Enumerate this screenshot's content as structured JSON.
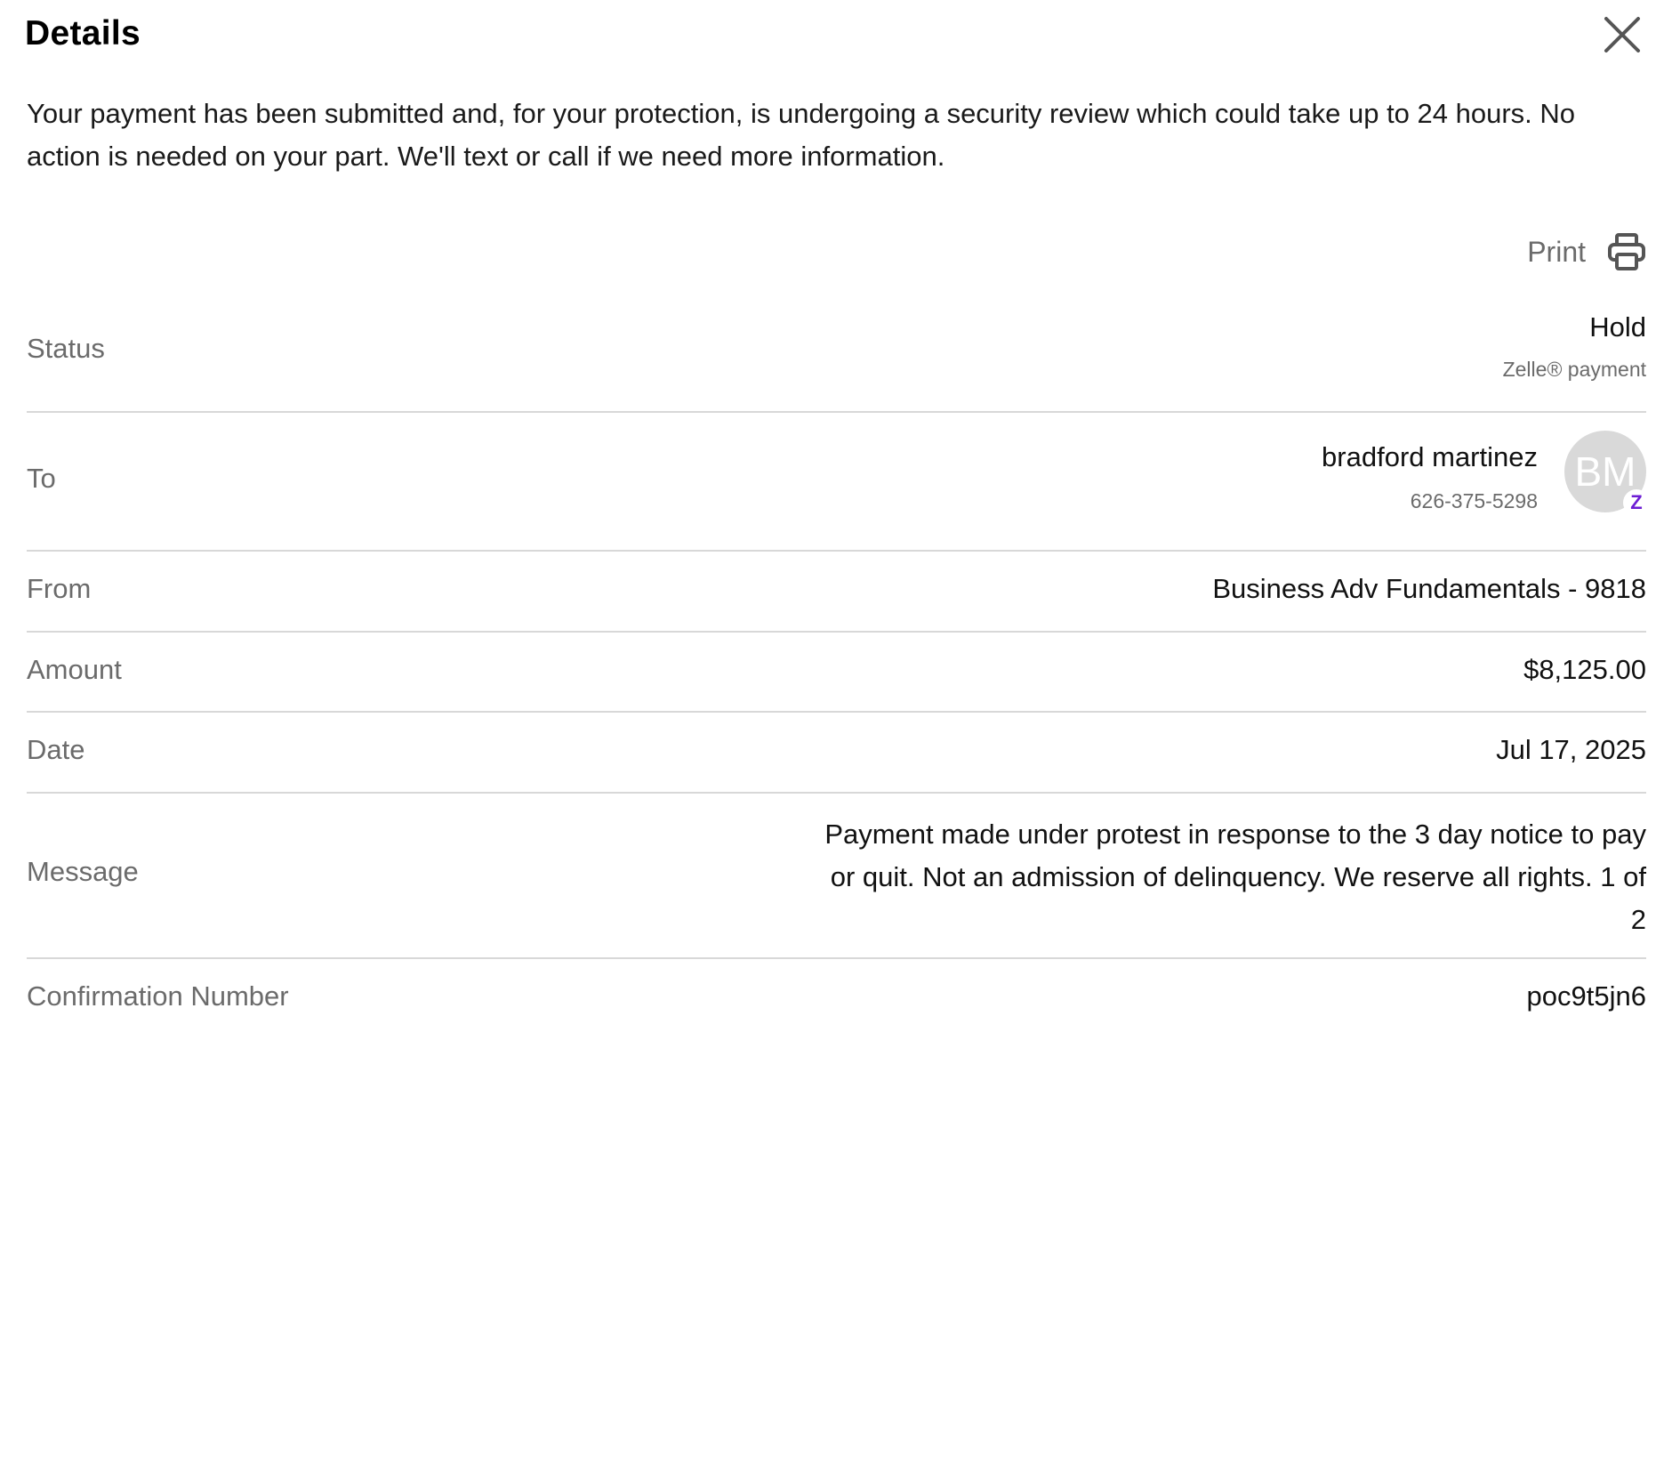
{
  "header": {
    "title": "Details"
  },
  "intro_text": "Your payment has been submitted and, for your protection, is undergoing a security review which could take up to 24 hours. No action is needed on your part. We'll text or call if we need more information.",
  "print": {
    "label": "Print",
    "icon": "printer-icon"
  },
  "details": {
    "status": {
      "label": "Status",
      "value": "Hold",
      "sub": "Zelle® payment"
    },
    "to": {
      "label": "To",
      "name": "bradford martinez",
      "phone": "626-375-5298",
      "avatar_initials": "BM",
      "badge_glyph": "Z",
      "badge_color": "#6d1ed4"
    },
    "from": {
      "label": "From",
      "value": "Business Adv Fundamentals - 9818"
    },
    "amount": {
      "label": "Amount",
      "value": "$8,125.00"
    },
    "date": {
      "label": "Date",
      "value": "Jul 17, 2025"
    },
    "message": {
      "label": "Message",
      "line1": "Payment made under protest in response to the 3 day notice to pay",
      "line2": "or quit. Not an admission of delinquency. We reserve all rights. 1 of",
      "line3": "2"
    },
    "confirmation": {
      "label": "Confirmation Number",
      "value": "poc9t5jn6"
    }
  }
}
